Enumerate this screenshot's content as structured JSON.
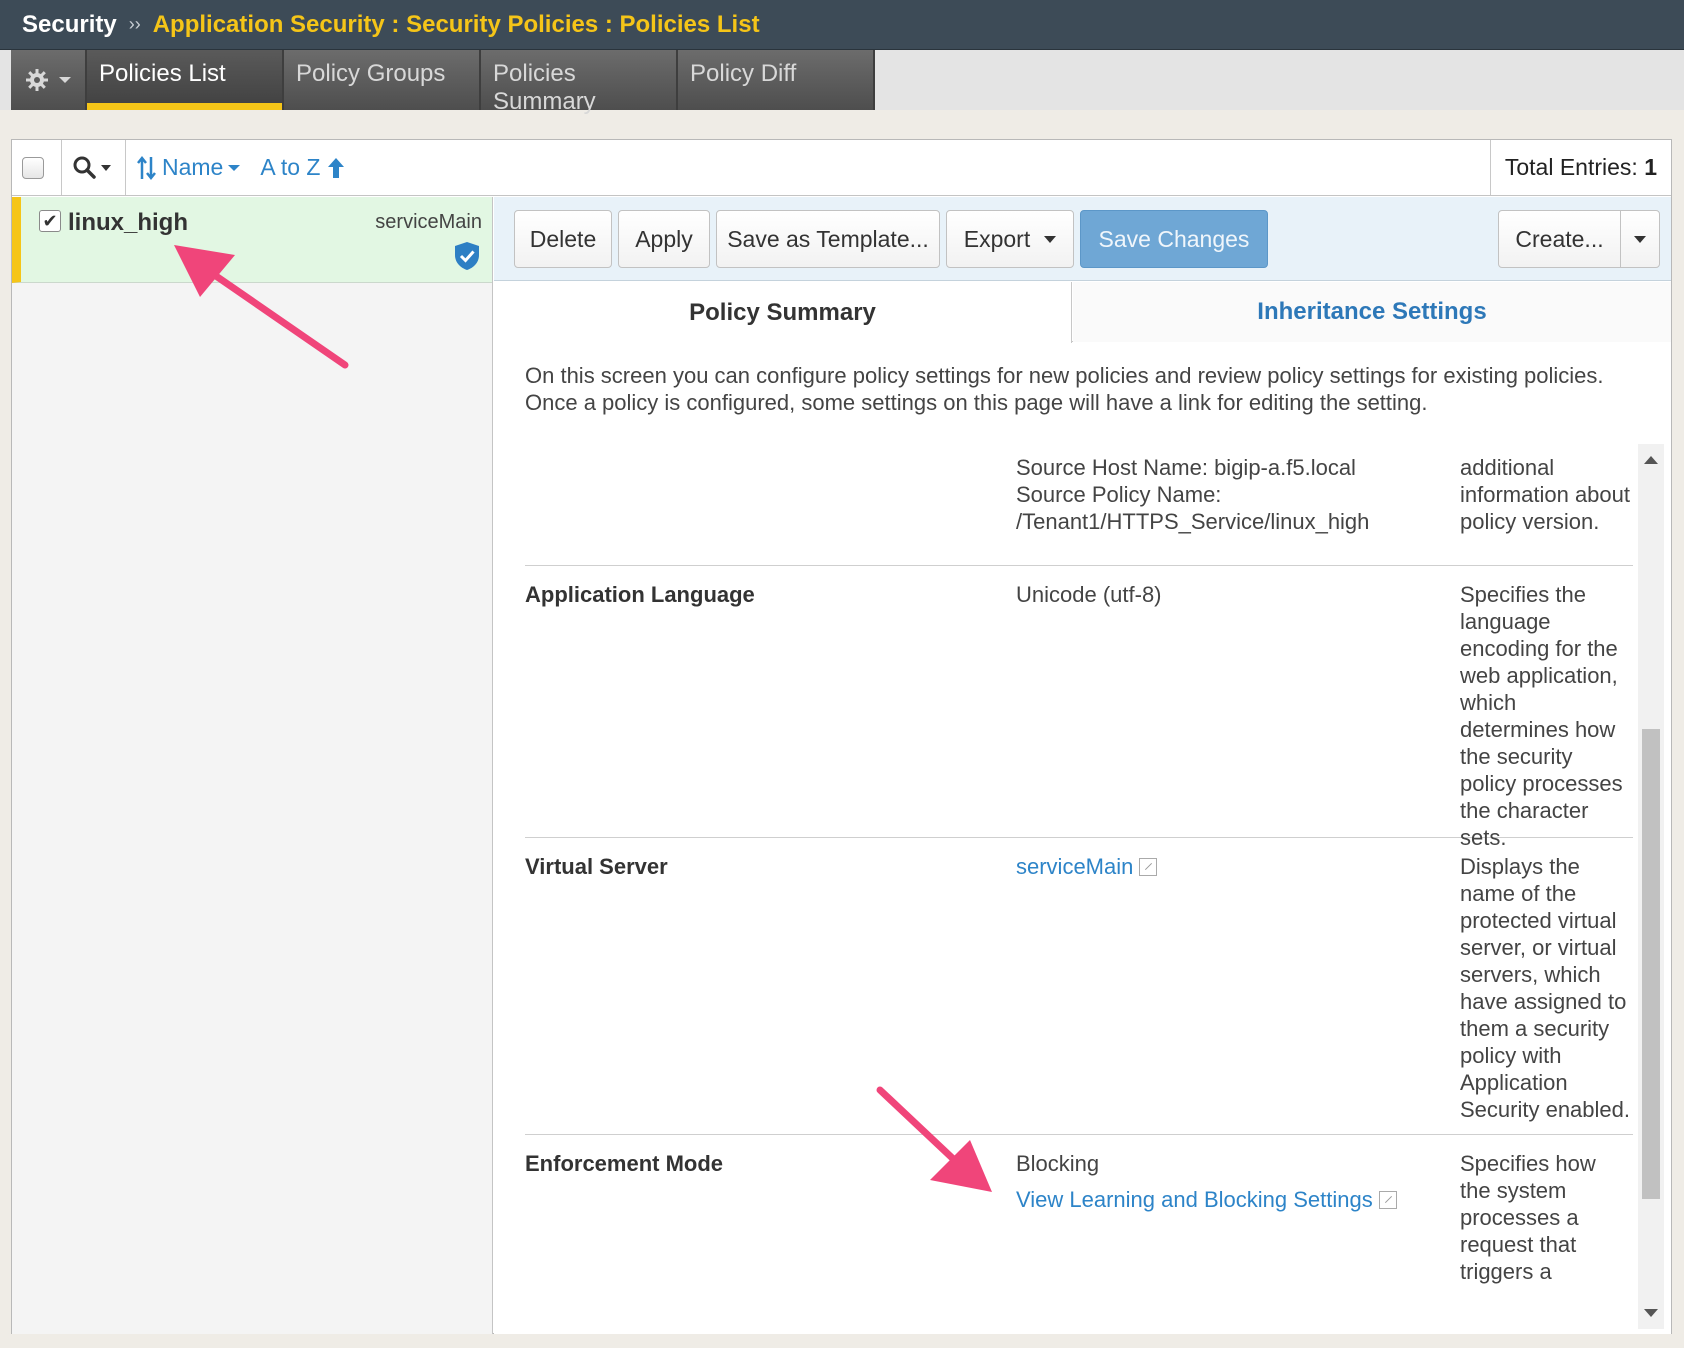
{
  "breadcrumb": {
    "root": "Security",
    "separator": "››",
    "path": "Application Security : Security Policies : Policies List"
  },
  "tabs": {
    "gear_icon": "gear-icon",
    "items": [
      {
        "label": "Policies List",
        "active": true
      },
      {
        "label": "Policy Groups",
        "active": false
      },
      {
        "label": "Policies Summary",
        "active": false
      },
      {
        "label": "Policy Diff",
        "active": false
      }
    ]
  },
  "listbar": {
    "sort_field": "Name",
    "sort_order": "A to Z",
    "total_label": "Total Entries:",
    "total_count": "1"
  },
  "policy_list": [
    {
      "name": "linux_high",
      "virtual_server": "serviceMain",
      "checked": true,
      "icon": "shield-check-icon"
    }
  ],
  "actions": {
    "delete": "Delete",
    "apply": "Apply",
    "save_template": "Save as Template...",
    "export": "Export",
    "save_changes": "Save Changes",
    "create": "Create..."
  },
  "subtabs": {
    "summary": "Policy Summary",
    "inheritance": "Inheritance Settings"
  },
  "intro": "On this screen you can configure policy settings for new policies and review policy settings for existing policies. Once a policy is configured, some settings on this page will have a link for editing the setting.",
  "summary_rows": {
    "source": {
      "label": "",
      "host": "Source Host Name: bigip-a.f5.local",
      "policy_name_label": "Source Policy Name:",
      "policy_path": "/Tenant1/HTTPS_Service/linux_high",
      "help": "additional information about policy version."
    },
    "language": {
      "label": "Application Language",
      "value": "Unicode (utf-8)",
      "help": "Specifies the language encoding for the web application, which determines how the security policy processes the character sets."
    },
    "virtual_server": {
      "label": "Virtual Server",
      "value": "serviceMain",
      "help": "Displays the name of the protected virtual server, or virtual servers, which have assigned to them a security policy with Application Security enabled."
    },
    "enforcement": {
      "label": "Enforcement Mode",
      "value": "Blocking",
      "link": "View Learning and Blocking Settings",
      "help": "Specifies how the system processes a request that triggers a"
    }
  },
  "colors": {
    "header_bg": "#3d4b57",
    "breadcrumb_accent": "#f5c518",
    "link": "#2d84c8",
    "selected_row": "#e2f7e3",
    "primary_button": "#6fa7d5",
    "annotation_arrow": "#f0457a"
  }
}
